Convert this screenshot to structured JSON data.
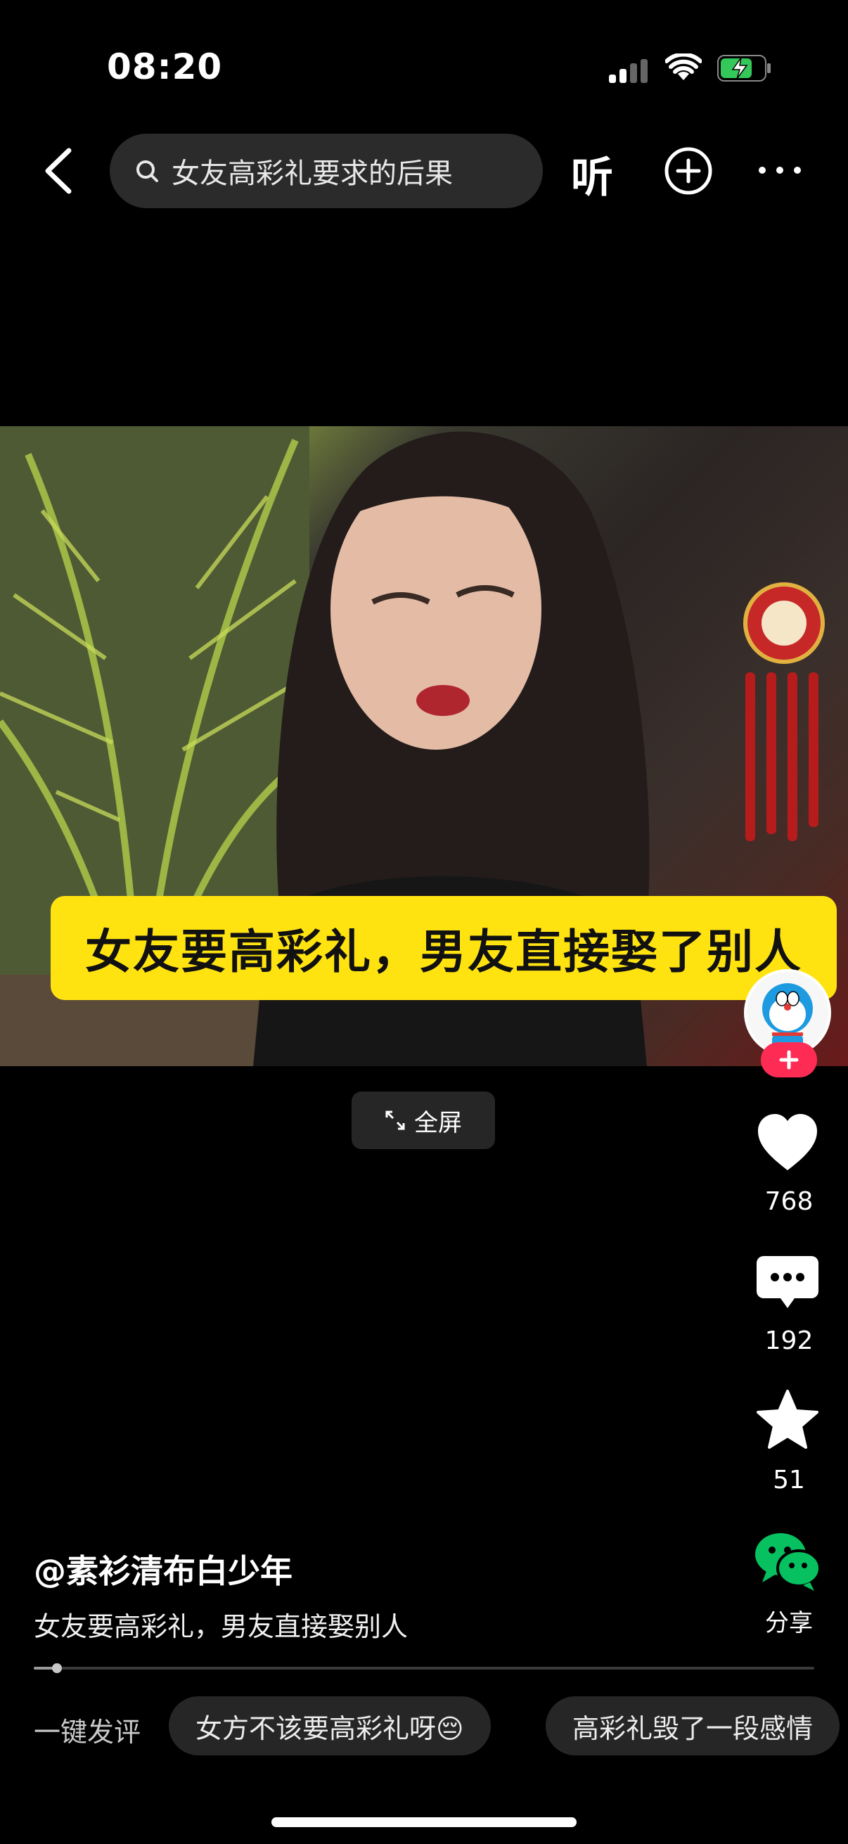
{
  "status": {
    "time": "08:20"
  },
  "nav": {
    "search_text": "女友高彩礼要求的后果",
    "listen_label": "听"
  },
  "video": {
    "caption": "女友要高彩礼，男友直接娶了别人",
    "fullscreen_label": "全屏"
  },
  "rail": {
    "likes": "768",
    "comments": "192",
    "favorites": "51",
    "share_label": "分享"
  },
  "info": {
    "author": "@素衫清布白少年",
    "description": "女友要高彩礼，男友直接娶别人",
    "progress": 0.03
  },
  "quick_comments": {
    "label": "一键发评",
    "chips": [
      "女方不该要高彩礼呀😔",
      "高彩礼毁了一段感情"
    ]
  },
  "colors": {
    "accent_red": "#fe2c55",
    "caption_yellow": "#ffe311",
    "wechat_green": "#07c160"
  }
}
